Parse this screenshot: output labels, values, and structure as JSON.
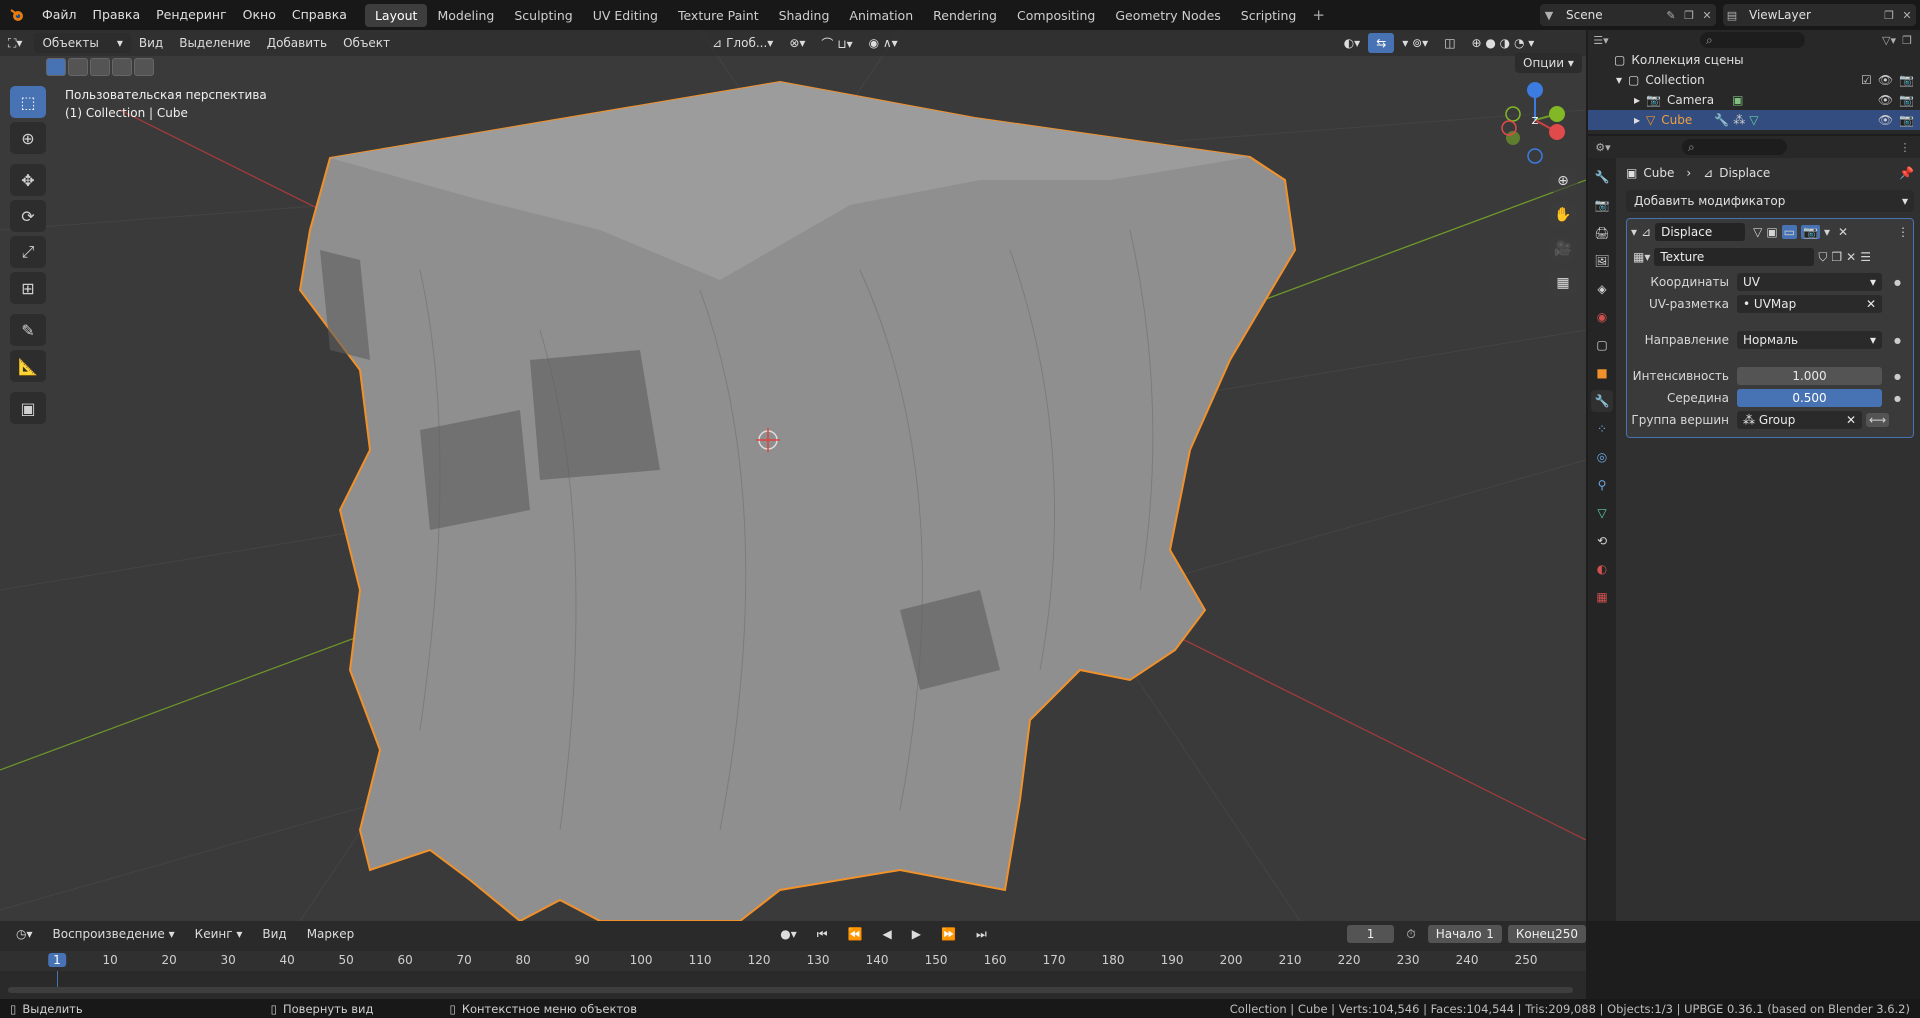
{
  "topbar": {
    "menus": [
      "Файл",
      "Правка",
      "Рендеринг",
      "Окно",
      "Справка"
    ],
    "workspaces": [
      "Layout",
      "Modeling",
      "Sculpting",
      "UV Editing",
      "Texture Paint",
      "Shading",
      "Animation",
      "Rendering",
      "Compositing",
      "Geometry Nodes",
      "Scripting"
    ],
    "active_workspace": "Layout",
    "scene": "Scene",
    "view_layer": "ViewLayer"
  },
  "viewport": {
    "mode": "Объекты",
    "menus": [
      "Вид",
      "Выделение",
      "Добавить",
      "Объект"
    ],
    "orientation": "Глоб...",
    "options": "Опции",
    "info_line1": "Пользовательская перспектива",
    "info_line2": "(1) Collection | Cube",
    "gizmo": {
      "z": "Z",
      "y": "Y",
      "x": "X"
    }
  },
  "outliner": {
    "root": "Коллекция сцены",
    "collection": "Collection",
    "items": [
      "Camera",
      "Cube"
    ]
  },
  "properties": {
    "crumb_object": "Cube",
    "crumb_modifier": "Displace",
    "add_modifier": "Добавить модификатор",
    "modifier_name": "Displace",
    "texture": "Texture",
    "rows": [
      {
        "label": "Координаты",
        "value": "UV"
      },
      {
        "label": "UV-разметка",
        "value": "UVMap"
      },
      {
        "label": "Направление",
        "value": "Нормаль"
      },
      {
        "label": "Интенсивность",
        "value": "1.000"
      },
      {
        "label": "Середина",
        "value": "0.500"
      },
      {
        "label": "Группа вершин",
        "value": "Group"
      }
    ]
  },
  "timeline": {
    "menus": [
      "Воспроизведение",
      "Кеинг",
      "Вид",
      "Маркер"
    ],
    "current_frame": "1",
    "start_label": "Начало",
    "start": "1",
    "end_label": "Конец",
    "end": "250",
    "ticks": [
      "1",
      "10",
      "20",
      "30",
      "40",
      "50",
      "60",
      "70",
      "80",
      "90",
      "100",
      "110",
      "120",
      "130",
      "140",
      "150",
      "160",
      "170",
      "180",
      "190",
      "200",
      "210",
      "220",
      "230",
      "240",
      "250"
    ]
  },
  "statusbar": {
    "select": "Выделить",
    "rotate": "Повернуть вид",
    "context": "Контекстное меню объектов",
    "stats": "Collection | Cube | Verts:104,546 | Faces:104,544 | Tris:209,088 | Objects:1/3 | UPBGE 0.36.1 (based on Blender 3.6.2)"
  },
  "colors": {
    "accent": "#4772b3",
    "selection_outline": "#f0912c",
    "grid_x": "#a83b3b",
    "grid_y": "#6f9a2a"
  }
}
